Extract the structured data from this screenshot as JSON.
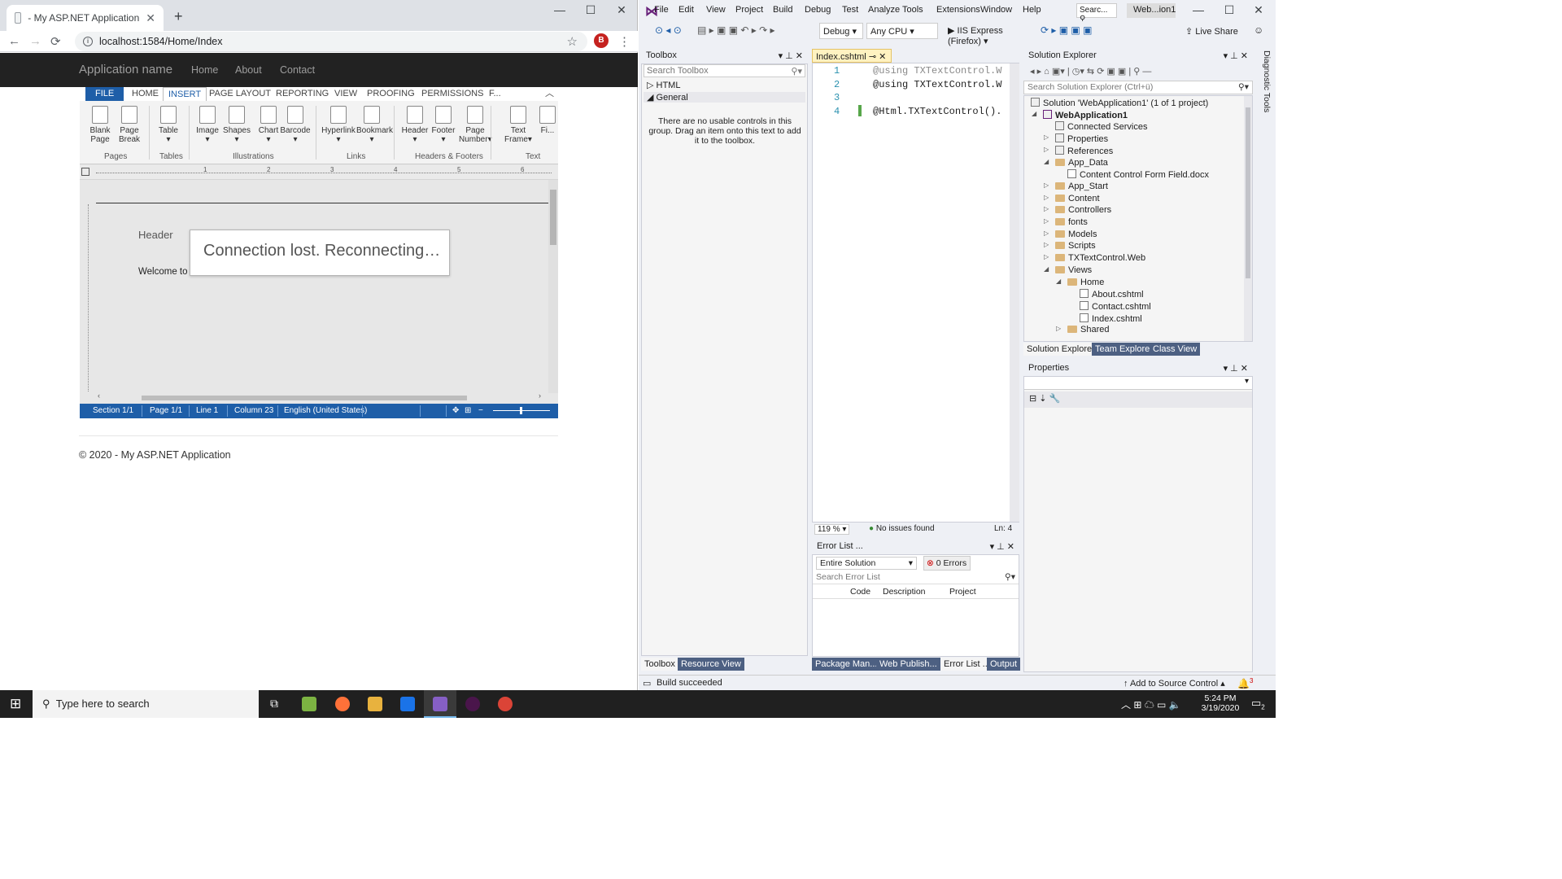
{
  "browser": {
    "tab_title": "- My ASP.NET Application",
    "new_tab": "+",
    "tab_close": "✕",
    "url": "localhost:1584/Home/Index",
    "avatar_letter": "B",
    "window_controls": [
      "—",
      "☐",
      "✕"
    ],
    "nav": [
      "←",
      "→",
      "⟳"
    ]
  },
  "site": {
    "brand": "Application name",
    "nav": [
      "Home",
      "About",
      "Contact"
    ],
    "footer": "© 2020 - My ASP.NET Application"
  },
  "editor": {
    "ribbon_tabs": [
      "FILE",
      "HOME",
      "INSERT",
      "PAGE LAYOUT",
      "REPORTING",
      "VIEW",
      "PROOFING",
      "PERMISSIONS",
      "F..."
    ],
    "active_tab": "INSERT",
    "buttons": [
      {
        "label": "Blank\nPage",
        "icon": "blank-page-icon"
      },
      {
        "label": "Page\nBreak",
        "icon": "page-break-icon"
      },
      {
        "label": "Table\n▾",
        "icon": "table-icon"
      },
      {
        "label": "Image\n▾",
        "icon": "image-icon"
      },
      {
        "label": "Shapes\n▾",
        "icon": "shapes-icon"
      },
      {
        "label": "Chart\n▾",
        "icon": "chart-icon"
      },
      {
        "label": "Barcode\n▾",
        "icon": "barcode-icon"
      },
      {
        "label": "Hyperlink\n▾",
        "icon": "hyperlink-icon"
      },
      {
        "label": "Bookmark\n▾",
        "icon": "bookmark-icon"
      },
      {
        "label": "Header\n▾",
        "icon": "header-icon"
      },
      {
        "label": "Footer\n▾",
        "icon": "footer-icon"
      },
      {
        "label": "Page\nNumber▾",
        "icon": "page-number-icon"
      },
      {
        "label": "Text\nFrame▾",
        "icon": "text-frame-icon"
      },
      {
        "label": "Fi...",
        "icon": "field-icon"
      }
    ],
    "groups": [
      "Pages",
      "Tables",
      "Illustrations",
      "Links",
      "Headers & Footers",
      "Text"
    ],
    "ruler_numbers": [
      "1",
      "2",
      "3",
      "4",
      "5",
      "6"
    ],
    "header_text": "Header",
    "body_text": "Welcome to T",
    "overlay": "Connection lost. Reconnecting…",
    "status": [
      "Section 1/1",
      "Page 1/1",
      "Line 1",
      "Column 23",
      "English (United States)"
    ]
  },
  "vs": {
    "menu": [
      "File",
      "Edit",
      "View",
      "Project",
      "Build",
      "Debug",
      "Test",
      "Analyze",
      "Tools",
      "Extensions",
      "Window",
      "Help"
    ],
    "search": "Searc...",
    "title": "Web...ion1",
    "config": "Debug",
    "platform": "Any CPU",
    "run": "IIS Express (Firefox)",
    "live_share": "Live Share",
    "toolbox": {
      "title": "Toolbox",
      "search": "Search Toolbox",
      "nodes": [
        "HTML",
        "General"
      ],
      "empty_msg": "There are no usable controls in this group. Drag an item onto this text to add it to the toolbox."
    },
    "editor_tab": "Index.cshtml",
    "code": [
      {
        "n": "1",
        "text": "@using TXTextControl.W"
      },
      {
        "n": "2",
        "text": "@using TXTextControl.W"
      },
      {
        "n": "3",
        "text": ""
      },
      {
        "n": "4",
        "text": "@Html.TXTextControl()."
      }
    ],
    "zoom": "119 %",
    "issues": "No issues found",
    "ln": "Ln: 4",
    "error_list": {
      "title": "Error List ...",
      "scope": "Entire Solution",
      "errors": "0 Errors",
      "search": "Search Error List",
      "columns": [
        "Code",
        "Description",
        "Project"
      ]
    },
    "solution_explorer": {
      "title": "Solution Explorer",
      "search": "Search Solution Explorer (Ctrl+ü)",
      "items": [
        {
          "label": "Solution 'WebApplication1' (1 of 1 project)",
          "indent": 0,
          "kind": "solution"
        },
        {
          "label": "WebApplication1",
          "indent": 1,
          "kind": "project"
        },
        {
          "label": "Connected Services",
          "indent": 2,
          "kind": "svc"
        },
        {
          "label": "Properties",
          "indent": 2,
          "kind": "props"
        },
        {
          "label": "References",
          "indent": 2,
          "kind": "refs"
        },
        {
          "label": "App_Data",
          "indent": 2,
          "kind": "folder"
        },
        {
          "label": "Content Control Form Field.docx",
          "indent": 3,
          "kind": "file"
        },
        {
          "label": "App_Start",
          "indent": 2,
          "kind": "folder"
        },
        {
          "label": "Content",
          "indent": 2,
          "kind": "folder"
        },
        {
          "label": "Controllers",
          "indent": 2,
          "kind": "folder"
        },
        {
          "label": "fonts",
          "indent": 2,
          "kind": "folder"
        },
        {
          "label": "Models",
          "indent": 2,
          "kind": "folder"
        },
        {
          "label": "Scripts",
          "indent": 2,
          "kind": "folder"
        },
        {
          "label": "TXTextControl.Web",
          "indent": 2,
          "kind": "folder"
        },
        {
          "label": "Views",
          "indent": 2,
          "kind": "folder"
        },
        {
          "label": "Home",
          "indent": 3,
          "kind": "folder"
        },
        {
          "label": "About.cshtml",
          "indent": 4,
          "kind": "file"
        },
        {
          "label": "Contact.cshtml",
          "indent": 4,
          "kind": "file"
        },
        {
          "label": "Index.cshtml",
          "indent": 4,
          "kind": "file"
        },
        {
          "label": "Shared",
          "indent": 3,
          "kind": "folder"
        }
      ],
      "tabs": [
        "Solution Explorer",
        "Team Explorer",
        "Class View"
      ]
    },
    "properties_title": "Properties",
    "bottom_tabs_left": [
      "Toolbox",
      "Resource View"
    ],
    "bottom_tabs_mid": [
      "Package Man...",
      "Web Publish...",
      "Error List ...",
      "Output"
    ],
    "diagnostic_tools": "Diagnostic Tools",
    "status": "Build succeeded",
    "source_control": "Add to Source Control ▴",
    "notif_count": "3"
  },
  "taskbar": {
    "search": "Type here to search",
    "time": "5:24 PM",
    "date": "3/19/2020",
    "notif": "2"
  }
}
